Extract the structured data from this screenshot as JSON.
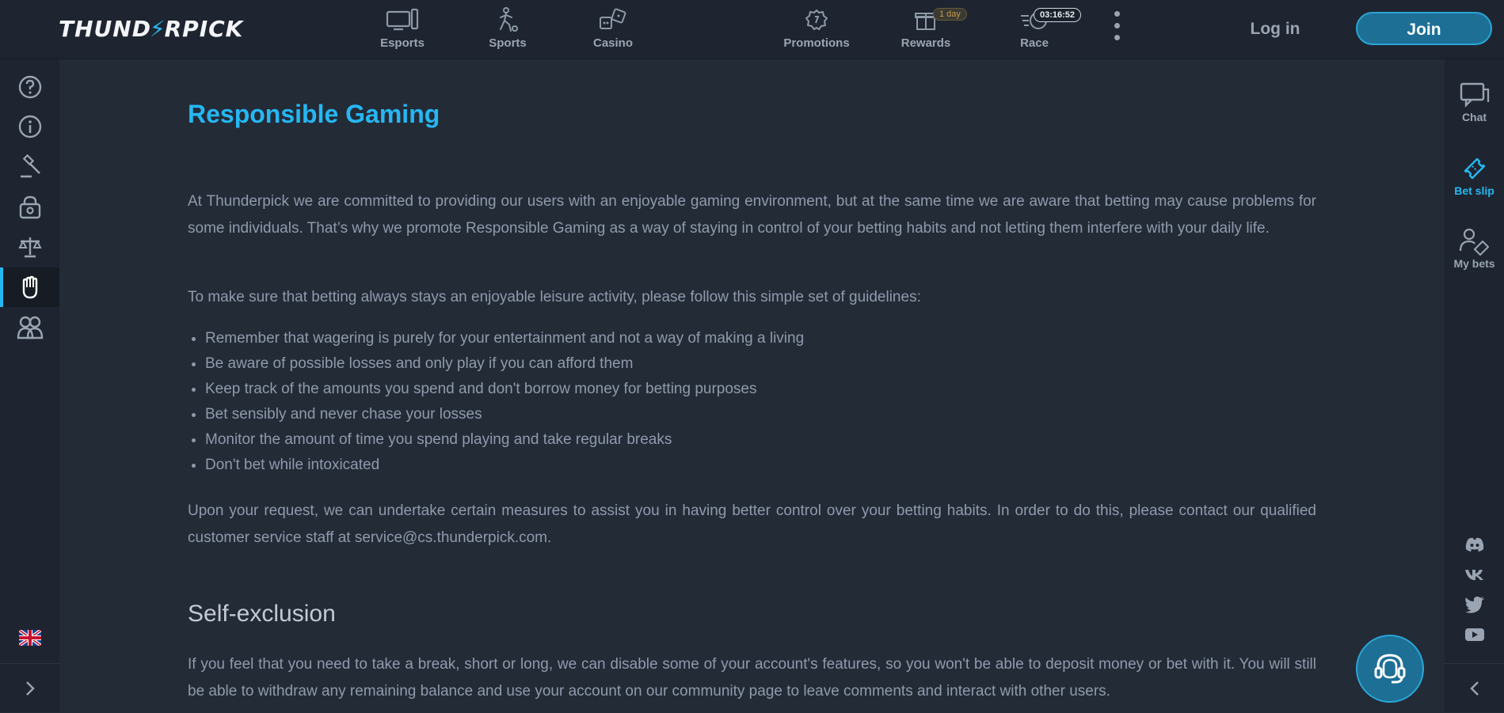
{
  "header": {
    "logo_text": "THUNDERPICK",
    "nav": [
      {
        "label": "Esports",
        "icon": "monitor-icon"
      },
      {
        "label": "Sports",
        "icon": "soccer-player-icon"
      },
      {
        "label": "Casino",
        "icon": "dice-icon"
      },
      {
        "label": "Promotions",
        "icon": "promotions-icon"
      },
      {
        "label": "Rewards",
        "icon": "gift-icon",
        "badge": "1 day"
      },
      {
        "label": "Race",
        "icon": "timer-icon",
        "badge": "03:16:52"
      }
    ],
    "login_label": "Log in",
    "join_label": "Join"
  },
  "left_sidebar": {
    "items": [
      {
        "icon": "help-icon"
      },
      {
        "icon": "info-icon"
      },
      {
        "icon": "gavel-icon"
      },
      {
        "icon": "privacy-lock-icon"
      },
      {
        "icon": "scales-icon"
      },
      {
        "icon": "hand-stop-icon",
        "active": true
      },
      {
        "icon": "affiliates-icon"
      }
    ],
    "language_icon": "uk-flag-icon"
  },
  "right_sidebar": {
    "items": [
      {
        "label": "Chat",
        "icon": "chat-icon"
      },
      {
        "label": "Bet slip",
        "icon": "ticket-icon",
        "active": true
      },
      {
        "label": "My bets",
        "icon": "my-bets-icon"
      }
    ],
    "socials": [
      "discord-icon",
      "vk-icon",
      "twitter-icon",
      "youtube-icon"
    ]
  },
  "main": {
    "title": "Responsible Gaming",
    "intro": "At Thunderpick we are committed to providing our users with an enjoyable gaming environment, but at the same time we are aware that betting may cause problems for some individuals. That’s why we promote Responsible Gaming as a way of staying in control of your betting habits and not letting them interfere with your daily life.",
    "guidelines_intro": "To make sure that betting always stays an enjoyable leisure activity, please follow this simple set of guidelines:",
    "guidelines": [
      "Remember that wagering is purely for your entertainment and not a way of making a living",
      "Be aware of possible losses and only play if you can afford them",
      "Keep track of the amounts you spend and don't borrow money for betting purposes",
      "Bet sensibly and never chase your losses",
      "Monitor the amount of time you spend playing and take regular breaks",
      "Don't bet while intoxicated"
    ],
    "contact": "Upon your request, we can undertake certain measures to assist you in having better control over your betting habits. In order to do this, please contact our qualified customer service staff at service@cs.thunderpick.com.",
    "self_exclusion_title": "Self-exclusion",
    "self_exclusion_text": "If you feel that you need to take a break, short or long, we can disable some of your account's features, so you won't be able to deposit money or bet with it. You will still be able to withdraw any remaining balance and use your account on our community page to leave comments and interact with other users."
  },
  "support_icon": "headset-icon",
  "colors": {
    "accent": "#26b7f2",
    "background": "#232b37",
    "bar": "#1e2530",
    "join": "#1d6f95"
  }
}
